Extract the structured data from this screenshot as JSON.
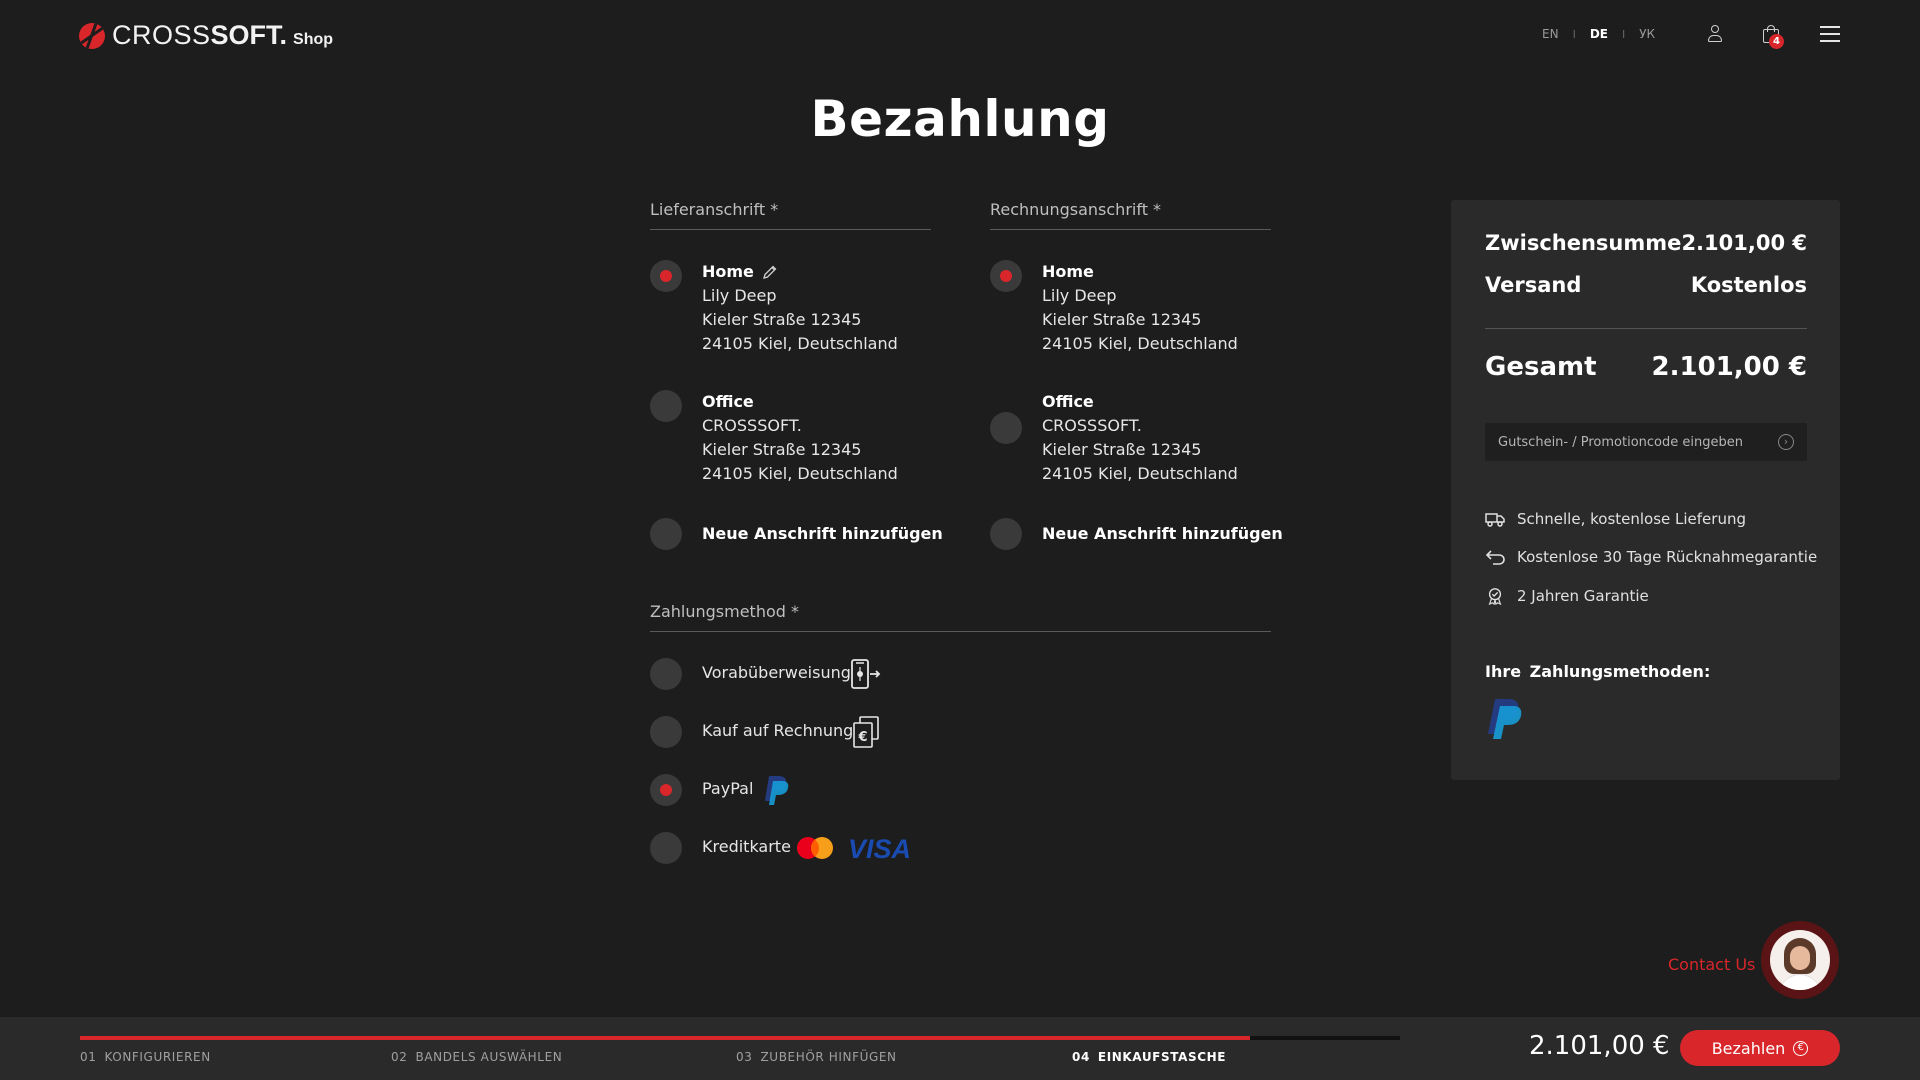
{
  "header": {
    "logo": {
      "cross": "CROSS",
      "soft": "SOFT.",
      "shop": "Shop"
    },
    "languages": [
      {
        "code": "EN",
        "active": false
      },
      {
        "code": "DE",
        "active": true
      },
      {
        "code": "УК",
        "active": false
      }
    ],
    "language_separator": "I",
    "cart_count": "4",
    "icons": [
      "user-icon",
      "shopping-bag-icon",
      "menu-icon"
    ]
  },
  "page_title": "Bezahlung",
  "shipping": {
    "heading": "Lieferanschrift *",
    "addresses": [
      {
        "name": "Home",
        "lines": [
          "Lily Deep",
          "Kieler Straße 12345",
          "24105 Kiel, Deutschland"
        ],
        "selected": true,
        "editable": true
      },
      {
        "name": "Office",
        "lines": [
          "CROSSSOFT.",
          "Kieler Straße 12345",
          "24105 Kiel, Deutschland"
        ],
        "selected": false
      }
    ],
    "add_label": "Neue Anschrift hinzufügen"
  },
  "billing": {
    "heading": "Rechnungsanschrift *",
    "addresses": [
      {
        "name": "Home",
        "lines": [
          "Lily Deep",
          "Kieler Straße 12345",
          "24105 Kiel, Deutschland"
        ],
        "selected": true
      },
      {
        "name": "Office",
        "lines": [
          "CROSSSOFT.",
          "Kieler Straße 12345",
          "24105 Kiel, Deutschland"
        ],
        "selected": false
      }
    ],
    "add_label": "Neue Anschrift hinzufügen"
  },
  "payment": {
    "heading": "Zahlungsmethod *",
    "methods": [
      {
        "label": "Vorabüberweisung",
        "icon": "bank-transfer-icon",
        "selected": false
      },
      {
        "label": "Kauf auf Rechnung",
        "icon": "invoice-euro-icon",
        "selected": false
      },
      {
        "label": "PayPal",
        "icon": "paypal-icon",
        "selected": true
      },
      {
        "label": "Kreditkarte",
        "icon": "mastercard-visa-icon",
        "selected": false,
        "brand_text": "VISA"
      }
    ]
  },
  "summary": {
    "subtotal_label": "Zwischensumme",
    "subtotal_value": "2.101,00 €",
    "shipping_label": "Versand",
    "shipping_value": "Kostenlos",
    "total_label": "Gesamt",
    "total_value": "2.101,00 €",
    "voucher_placeholder": "Gutschein- / Promotioncode eingeben",
    "benefits": [
      {
        "icon": "truck-icon",
        "text": "Schnelle, kostenlose Lieferung"
      },
      {
        "icon": "return-arrow-icon",
        "text": "Kostenlose 30 Tage Rücknahmegarantie"
      },
      {
        "icon": "award-icon",
        "text": "2 Jahren Garantie"
      }
    ],
    "payment_methods_title": "Ihre  Zahlungsmethoden:"
  },
  "contact": {
    "label": "Contact Us"
  },
  "bottom_bar": {
    "steps": [
      {
        "num": "01",
        "label": "KONFIGURIEREN"
      },
      {
        "num": "02",
        "label": "BANDELS AUSWÄHLEN"
      },
      {
        "num": "03",
        "label": "ZUBEHÖR HINFÜGEN"
      },
      {
        "num": "04",
        "label": "EINKAUFSTASCHE",
        "current": true
      }
    ],
    "progress_percent": 88.6,
    "total": "2.101,00 €",
    "pay_button_label": "Bezahlen"
  },
  "colors": {
    "background": "#1d1d1d",
    "panel": "#2a2a2a",
    "accent": "#d8262b",
    "paypal_dark": "#253b80",
    "paypal_light": "#179bd7",
    "visa_blue": "#1a1f71"
  }
}
